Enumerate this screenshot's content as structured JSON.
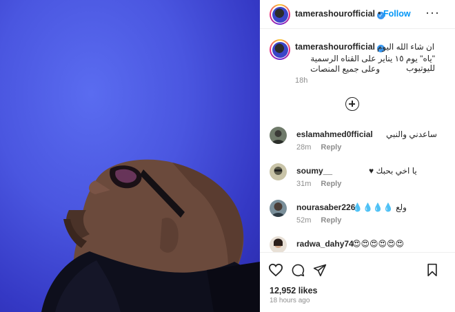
{
  "post": {
    "username": "tamerashourofficial",
    "verified_mark": "✓",
    "separator": "•",
    "follow_label": "Follow",
    "more_label": "···"
  },
  "caption": {
    "username": "tamerashourofficial",
    "lines": [
      "ان شاء الله اليوم",
      "\"ياه\" يوم ١٥ يناير على القناه الرسمية لليوتيوب",
      "وعلى جميع المنصات"
    ],
    "time": "18h"
  },
  "comments": [
    {
      "user": "eslamahmed0fficial",
      "text": "ساعدني والنبي",
      "time": "28m",
      "reply": "Reply"
    },
    {
      "user": "soumy__",
      "text": "يا اخي بحبك ♥",
      "time": "31m",
      "reply": "Reply"
    },
    {
      "user": "nourasaber226",
      "text": "ولع 💧💧💧💧",
      "time": "52m",
      "reply": "Reply"
    },
    {
      "user": "radwa_dahy74",
      "text": "😍😍😍😍😍😍",
      "time": "",
      "reply": ""
    }
  ],
  "footer": {
    "likes": "12,952 likes",
    "time_ago": "18 hours ago"
  },
  "icons": [
    "heart-icon",
    "comment-icon",
    "share-icon",
    "bookmark-icon",
    "add-comment-icon",
    "verified-icon"
  ],
  "colors": {
    "accent": "#0095f6",
    "verified": "#3897f0",
    "photo_bg": "#4a56e0"
  }
}
